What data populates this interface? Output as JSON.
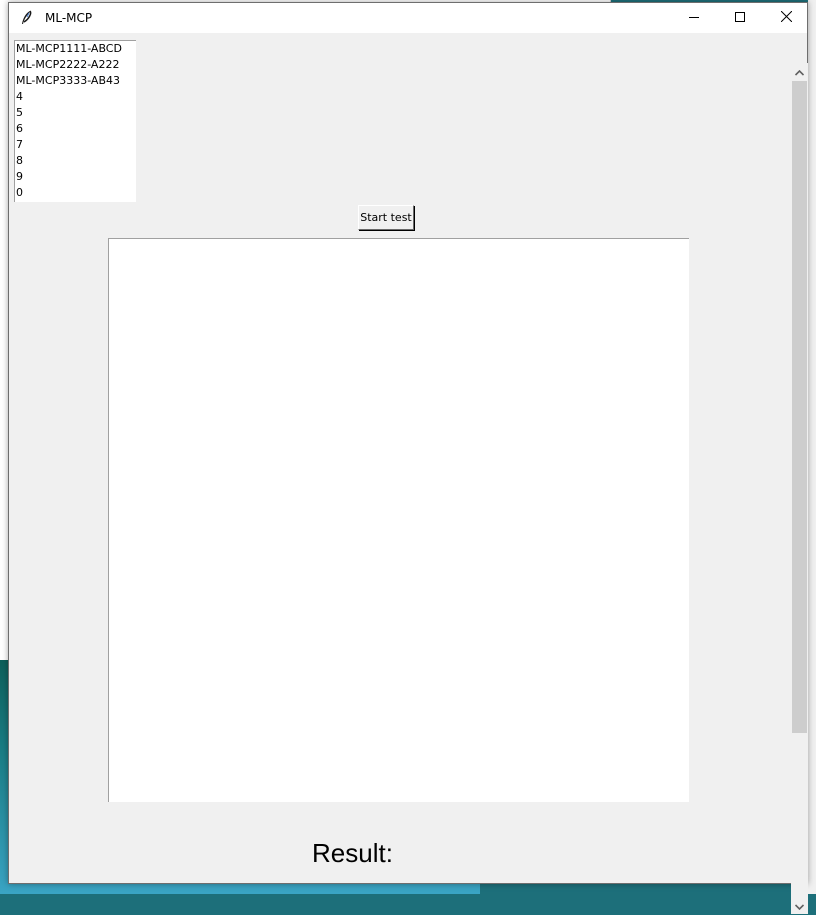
{
  "window": {
    "title": "ML-MCP",
    "app_icon": "feather-icon",
    "controls": {
      "minimize": "minimize-icon",
      "maximize": "maximize-icon",
      "close": "close-icon"
    }
  },
  "listbox": {
    "items": [
      "ML-MCP1111-ABCD",
      "ML-MCP2222-A222",
      "ML-MCP3333-AB43",
      "4",
      "5",
      "6",
      "7",
      "8",
      "9",
      "0"
    ]
  },
  "toolbar": {
    "start_label": "Start test"
  },
  "result": {
    "label": "Result:"
  },
  "scrollbar": {
    "position_fraction": 0.0,
    "visible_fraction": 0.8
  }
}
